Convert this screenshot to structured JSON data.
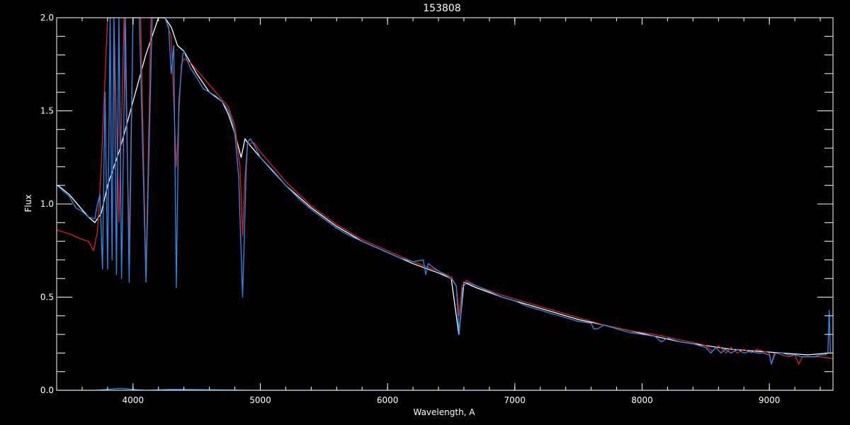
{
  "chart_data": {
    "type": "line",
    "title": "153808",
    "xlabel": "Wavelength, A",
    "ylabel": "Flux",
    "xlim": [
      3400,
      9500
    ],
    "ylim": [
      0.0,
      2.0
    ],
    "x_ticks": [
      4000,
      5000,
      6000,
      7000,
      8000,
      9000
    ],
    "x_tick_labels": [
      "4000",
      "5000",
      "6000",
      "7000",
      "8000",
      "9000"
    ],
    "y_ticks": [
      0.0,
      0.5,
      1.0,
      1.5,
      2.0
    ],
    "y_tick_labels": [
      "0.0",
      "0.5",
      "1.0",
      "1.5",
      "2.0"
    ],
    "x_minor_step": 200,
    "y_minor_step": 0.1,
    "grid": false,
    "series": [
      {
        "color": "#ffffff",
        "style": "observed spectrum",
        "x": [
          3410,
          3500,
          3600,
          3650,
          3700,
          3750,
          3800,
          3900,
          4000,
          4100,
          4200,
          4250,
          4300,
          4350,
          4400,
          4500,
          4600,
          4700,
          4750,
          4800,
          4850,
          4880,
          4900,
          5000,
          5200,
          5400,
          5600,
          5800,
          6000,
          6200,
          6400,
          6500,
          6560,
          6600,
          6700,
          6900,
          7100,
          7300,
          7500,
          7700,
          7900,
          8100,
          8300,
          8500,
          8700,
          8900,
          9100,
          9300,
          9470
        ],
        "y": [
          1.1,
          1.05,
          0.97,
          0.93,
          0.9,
          0.95,
          1.1,
          1.3,
          1.55,
          1.8,
          2.02,
          2.0,
          1.95,
          1.85,
          1.82,
          1.7,
          1.6,
          1.55,
          1.48,
          1.38,
          1.25,
          1.35,
          1.33,
          1.25,
          1.1,
          0.98,
          0.88,
          0.8,
          0.74,
          0.68,
          0.63,
          0.6,
          0.3,
          0.58,
          0.55,
          0.5,
          0.46,
          0.42,
          0.38,
          0.35,
          0.32,
          0.29,
          0.26,
          0.24,
          0.22,
          0.21,
          0.2,
          0.19,
          0.2
        ]
      },
      {
        "color": "#dd2020",
        "style": "model spectrum",
        "x": [
          3400,
          3500,
          3600,
          3650,
          3690,
          3720,
          3750,
          3800,
          3850,
          3890,
          3930,
          3970,
          4000,
          4060,
          4102,
          4140,
          4200,
          4250,
          4300,
          4340,
          4380,
          4400,
          4450,
          4500,
          4550,
          4600,
          4650,
          4700,
          4750,
          4800,
          4840,
          4861,
          4880,
          4900,
          4950,
          5000,
          5200,
          5400,
          5600,
          5800,
          6000,
          6200,
          6400,
          6500,
          6540,
          6563,
          6585,
          6620,
          6700,
          6900,
          7100,
          7300,
          7500,
          7700,
          7900,
          8100,
          8300,
          8450,
          8500,
          8550,
          8600,
          8660,
          8700,
          8750,
          8800,
          8860,
          8900,
          8950,
          9000,
          9015,
          9050,
          9100,
          9150,
          9200,
          9230,
          9260,
          9300,
          9400,
          9500
        ],
        "y": [
          0.86,
          0.84,
          0.81,
          0.8,
          0.75,
          0.85,
          1.2,
          2.0,
          2.2,
          0.9,
          2.2,
          0.8,
          2.0,
          2.2,
          0.6,
          2.2,
          2.1,
          2.05,
          1.9,
          1.2,
          1.75,
          1.78,
          1.76,
          1.72,
          1.68,
          1.64,
          1.6,
          1.56,
          1.52,
          1.42,
          1.2,
          0.83,
          1.15,
          1.32,
          1.33,
          1.28,
          1.12,
          0.99,
          0.89,
          0.81,
          0.75,
          0.69,
          0.64,
          0.61,
          0.56,
          0.4,
          0.56,
          0.59,
          0.56,
          0.51,
          0.47,
          0.43,
          0.39,
          0.35,
          0.32,
          0.3,
          0.27,
          0.25,
          0.24,
          0.21,
          0.24,
          0.2,
          0.23,
          0.2,
          0.22,
          0.2,
          0.22,
          0.21,
          0.2,
          0.14,
          0.2,
          0.19,
          0.18,
          0.19,
          0.14,
          0.18,
          0.18,
          0.18,
          0.17
        ]
      },
      {
        "color": "#2b8cf0",
        "style": "observed spectrum (overlay)",
        "x": [
          3400,
          3420,
          3450,
          3500,
          3550,
          3600,
          3650,
          3700,
          3720,
          3740,
          3760,
          3780,
          3800,
          3820,
          3835,
          3850,
          3870,
          3889,
          3910,
          3940,
          3970,
          4000,
          4050,
          4102,
          4150,
          4200,
          4250,
          4280,
          4300,
          4320,
          4340,
          4360,
          4390,
          4400,
          4420,
          4450,
          4500,
          4550,
          4600,
          4650,
          4700,
          4750,
          4780,
          4800,
          4830,
          4861,
          4890,
          4900,
          4920,
          4950,
          5000,
          5100,
          5200,
          5300,
          5400,
          5500,
          5600,
          5700,
          5800,
          5900,
          6000,
          6100,
          6200,
          6280,
          6300,
          6320,
          6400,
          6500,
          6540,
          6563,
          6590,
          6620,
          6700,
          6800,
          6900,
          7000,
          7100,
          7200,
          7300,
          7400,
          7500,
          7600,
          7620,
          7650,
          7700,
          7800,
          7900,
          8000,
          8100,
          8150,
          8200,
          8300,
          8400,
          8450,
          8500,
          8540,
          8580,
          8620,
          8650,
          8700,
          8750,
          8800,
          8850,
          8900,
          8950,
          9000,
          9015,
          9040,
          9100,
          9150,
          9200,
          9250,
          9300,
          9350,
          9400,
          9440,
          9460,
          9470,
          9480,
          9490,
          9500
        ],
        "y": [
          1.1,
          1.09,
          1.07,
          1.04,
          0.98,
          0.96,
          0.93,
          0.92,
          1.0,
          1.05,
          0.65,
          1.6,
          0.65,
          2.0,
          0.7,
          2.0,
          0.62,
          2.2,
          0.6,
          2.2,
          0.58,
          2.2,
          2.2,
          0.58,
          2.2,
          2.2,
          2.0,
          1.95,
          1.7,
          1.85,
          0.55,
          1.55,
          1.8,
          1.82,
          1.78,
          1.73,
          1.68,
          1.62,
          1.6,
          1.58,
          1.55,
          1.5,
          1.44,
          1.38,
          1.15,
          0.5,
          1.2,
          1.33,
          1.35,
          1.32,
          1.25,
          1.18,
          1.1,
          1.03,
          0.97,
          0.92,
          0.87,
          0.83,
          0.8,
          0.77,
          0.74,
          0.71,
          0.69,
          0.7,
          0.62,
          0.68,
          0.64,
          0.6,
          0.56,
          0.3,
          0.55,
          0.58,
          0.56,
          0.53,
          0.5,
          0.48,
          0.45,
          0.43,
          0.41,
          0.39,
          0.37,
          0.36,
          0.33,
          0.33,
          0.35,
          0.33,
          0.31,
          0.3,
          0.29,
          0.26,
          0.28,
          0.26,
          0.25,
          0.24,
          0.23,
          0.2,
          0.23,
          0.2,
          0.22,
          0.2,
          0.22,
          0.2,
          0.21,
          0.2,
          0.2,
          0.19,
          0.14,
          0.2,
          0.2,
          0.19,
          0.19,
          0.18,
          0.18,
          0.18,
          0.19,
          0.19,
          0.2,
          0.43,
          0.2,
          0.2,
          0.2
        ]
      },
      {
        "color": "#2b8cf0",
        "style": "near-zero baseline",
        "x": [
          3400,
          3700,
          3900,
          4100,
          4300,
          5000,
          6000,
          7000,
          8000,
          9000,
          9500
        ],
        "y": [
          0.0,
          0.0,
          0.01,
          0.0,
          0.005,
          0.0,
          0.0,
          0.0,
          0.0,
          0.0,
          0.0
        ]
      }
    ]
  }
}
